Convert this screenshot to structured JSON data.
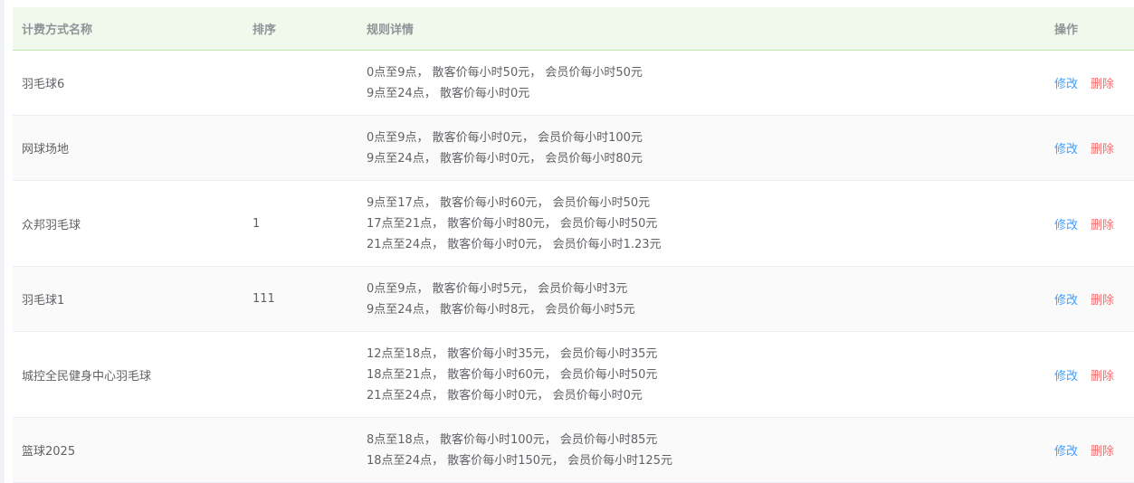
{
  "columns": {
    "name": "计费方式名称",
    "sort": "排序",
    "rules": "规则详情",
    "ops": "操作"
  },
  "actions": {
    "edit": "修改",
    "delete": "删除"
  },
  "rows": [
    {
      "name": "羽毛球6",
      "sort": "",
      "rules": [
        "0点至9点， 散客价每小时50元， 会员价每小时50元",
        "9点至24点， 散客价每小时0元"
      ]
    },
    {
      "name": "网球场地",
      "sort": "",
      "rules": [
        "0点至9点， 散客价每小时0元， 会员价每小时100元",
        "9点至24点， 散客价每小时0元， 会员价每小时80元"
      ]
    },
    {
      "name": "众邦羽毛球",
      "sort": "1",
      "rules": [
        "9点至17点， 散客价每小时60元， 会员价每小时50元",
        "17点至21点， 散客价每小时80元， 会员价每小时50元",
        "21点至24点， 散客价每小时0元， 会员价每小时1.23元"
      ]
    },
    {
      "name": "羽毛球1",
      "sort": "111",
      "rules": [
        "0点至9点， 散客价每小时5元， 会员价每小时3元",
        "9点至24点， 散客价每小时8元， 会员价每小时5元"
      ]
    },
    {
      "name": "城控全民健身中心羽毛球",
      "sort": "",
      "rules": [
        "12点至18点， 散客价每小时35元， 会员价每小时35元",
        "18点至21点， 散客价每小时60元， 会员价每小时50元",
        "21点至24点， 散客价每小时0元， 会员价每小时0元"
      ]
    },
    {
      "name": "篮球2025",
      "sort": "",
      "rules": [
        "8点至18点， 散客价每小时100元， 会员价每小时85元",
        "18点至24点， 散客价每小时150元， 会员价每小时125元"
      ]
    }
  ]
}
